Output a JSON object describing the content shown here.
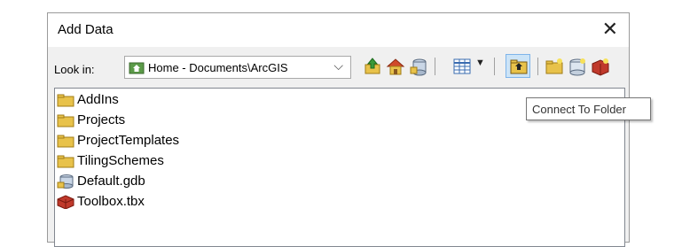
{
  "dialog": {
    "title": "Add Data",
    "close_glyph": "✕"
  },
  "lookin": {
    "label": "Look in:",
    "value": "Home - Documents\\ArcGIS",
    "icon": "home-folder-icon",
    "arrow_glyph": "⌵"
  },
  "toolbar": {
    "buttons": [
      {
        "name": "up-one-level-icon"
      },
      {
        "name": "home-icon"
      },
      {
        "name": "geodatabase-connect-icon"
      },
      {
        "name": "view-options-icon"
      },
      {
        "name": "connect-to-folder-icon"
      },
      {
        "name": "new-folder-icon"
      },
      {
        "name": "new-geodatabase-icon"
      },
      {
        "name": "new-toolbox-icon"
      }
    ]
  },
  "items": [
    {
      "label": "AddIns",
      "icon": "folder-icon"
    },
    {
      "label": "Projects",
      "icon": "folder-icon"
    },
    {
      "label": "ProjectTemplates",
      "icon": "folder-icon"
    },
    {
      "label": "TilingSchemes",
      "icon": "folder-icon"
    },
    {
      "label": "Default.gdb",
      "icon": "geodatabase-icon"
    },
    {
      "label": "Toolbox.tbx",
      "icon": "toolbox-icon"
    }
  ],
  "tooltip": {
    "text": "Connect To Folder"
  },
  "colors": {
    "folder": "#e8c24a",
    "folder_dark": "#c29a22",
    "accent": "#cce4f7",
    "toolbox": "#c0392b"
  }
}
